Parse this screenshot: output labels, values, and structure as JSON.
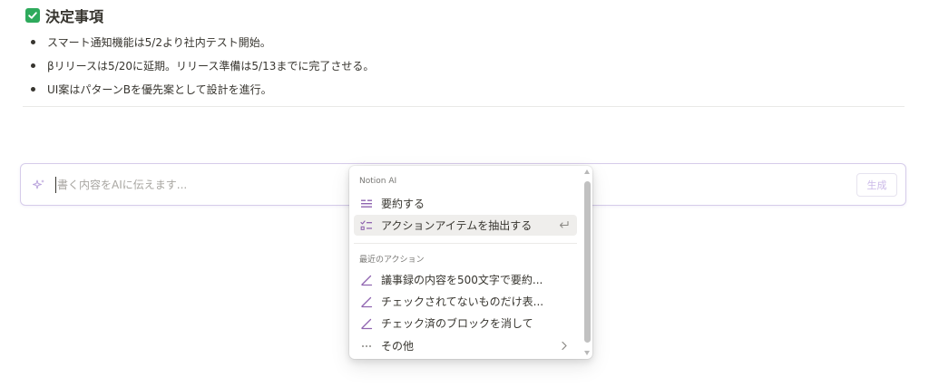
{
  "section": {
    "title": "決定事項",
    "check_icon": "checkbox-checked-icon",
    "accent": "#2eaa5c",
    "bullets": [
      "スマート通知機能は5/2より社内テスト開始。",
      "βリリースは5/20に延期。リリース準備は5/13までに完了させる。",
      "UI案はパターンBを優先案として設計を進行。"
    ]
  },
  "ai_bar": {
    "icon": "sparkle-icon",
    "placeholder": "書く内容をAIに伝えます...",
    "value": "",
    "generate_label": "生成"
  },
  "ai_menu": {
    "header": "Notion AI",
    "items": [
      {
        "label": "要約する",
        "icon": "summarize-icon"
      },
      {
        "label": "アクションアイテムを抽出する",
        "icon": "checklist-icon",
        "selected": true,
        "shortcut_icon": "enter-icon"
      }
    ],
    "recent_header": "最近のアクション",
    "recent_items": [
      {
        "label": "議事録の内容を500文字で要約...",
        "icon": "pen-icon"
      },
      {
        "label": "チェックされてないものだけ表...",
        "icon": "pen-icon"
      },
      {
        "label": "チェック済のブロックを消して",
        "icon": "pen-icon"
      }
    ],
    "more": {
      "label": "その他",
      "icon": "more-icon",
      "chevron_icon": "chevron-right-icon"
    }
  },
  "colors": {
    "ai_accent": "#9065b0",
    "text": "#37352f",
    "muted": "#787774"
  }
}
